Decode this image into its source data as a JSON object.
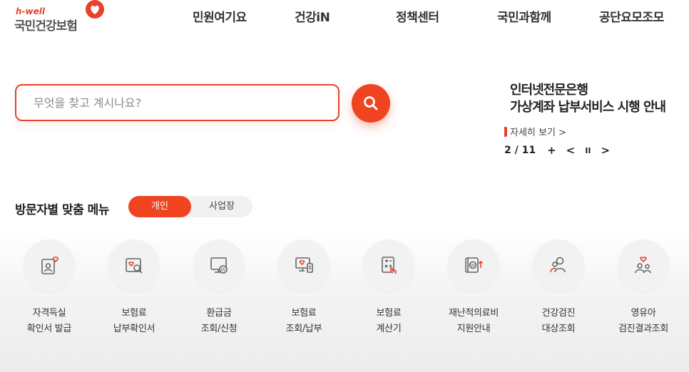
{
  "logo": {
    "tag": "h-well",
    "name": "국민건강보험"
  },
  "nav": [
    {
      "label": "민원여기요"
    },
    {
      "label": "건강iN"
    },
    {
      "label": "정책센터"
    },
    {
      "label": "국민과함께"
    },
    {
      "label": "공단요모조모"
    }
  ],
  "search": {
    "placeholder": "무엇을 찾고 계시나요?",
    "value": "",
    "button_icon": "search-icon"
  },
  "notice": {
    "title_line1": "인터넷전문은행",
    "title_line2": "가상계좌 납부서비스 시행 안내",
    "more": "자세히 보기 >",
    "page_count": "2 / 11",
    "add": "+",
    "prev": "<",
    "pause": "II",
    "next": ">"
  },
  "visitor_menu": {
    "label": "방문자별 맞춤 메뉴",
    "toggle_active": "개인",
    "toggle_inactive": "사업장"
  },
  "menu_items": [
    {
      "line1": "자격득실",
      "line2": "확인서 발급",
      "icon": "certificate-heart-icon"
    },
    {
      "line1": "보험료",
      "line2": "납부확인서",
      "icon": "document-search-icon"
    },
    {
      "line1": "환급금",
      "line2": "조회/신청",
      "icon": "monitor-won-icon"
    },
    {
      "line1": "보험료",
      "line2": "조회/납부",
      "icon": "monitor-heart-icon"
    },
    {
      "line1": "보험료",
      "line2": "계산기",
      "icon": "calculator-icon"
    },
    {
      "line1": "재난적의료비",
      "line2": "지원안내",
      "icon": "wallet-won-icon"
    },
    {
      "line1": "건강검진",
      "line2": "대상조회",
      "icon": "people-icon"
    },
    {
      "line1": "영유아",
      "line2": "검진결과조회",
      "icon": "family-heart-icon"
    }
  ],
  "colors": {
    "accent": "#f0431f",
    "text": "#222222",
    "muted": "#8a8a8a",
    "circle": "#f2f2f2"
  }
}
